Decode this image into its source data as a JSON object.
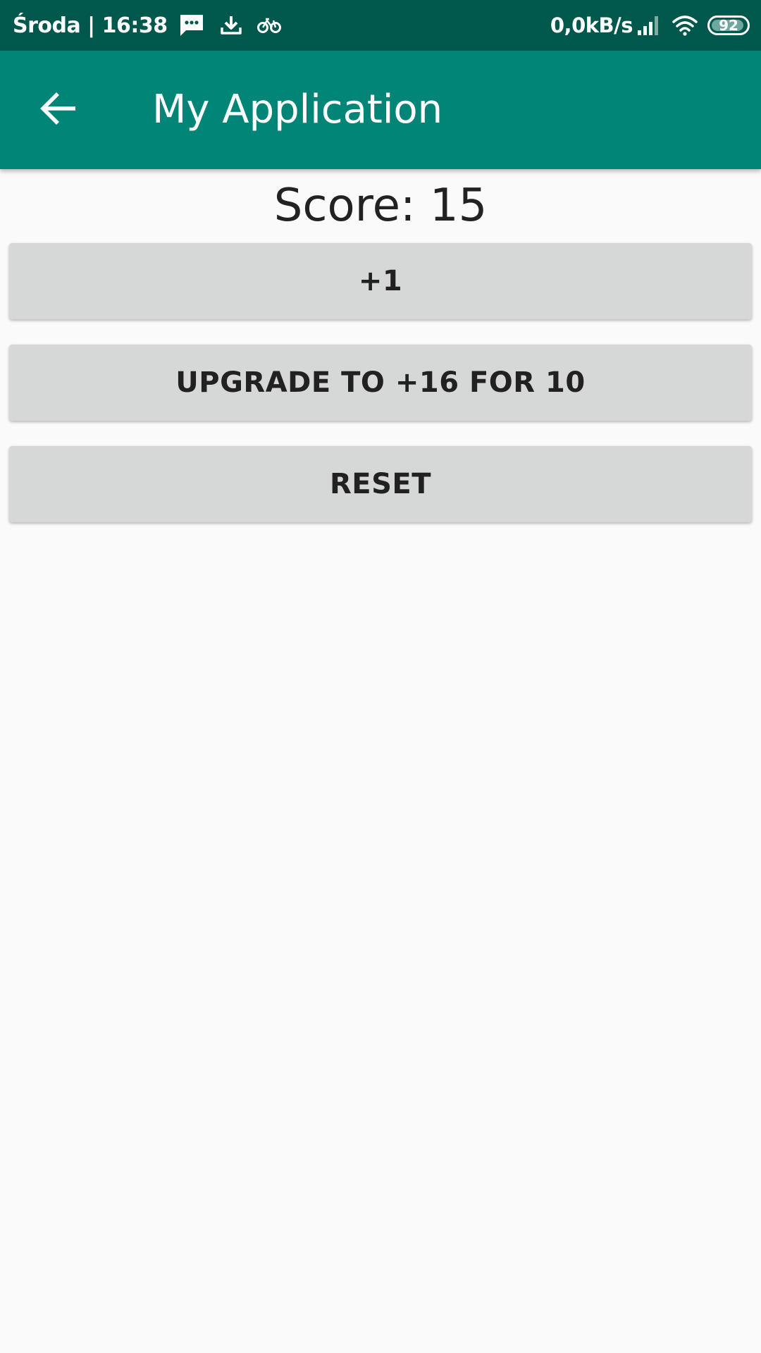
{
  "status_bar": {
    "day_time": "Środa | 16:38",
    "net_speed": "0,0kB/s",
    "battery_level": "92",
    "icons": [
      "message-icon",
      "download-icon",
      "bike-icon",
      "signal-icon",
      "wifi-icon",
      "battery-icon"
    ]
  },
  "app_bar": {
    "title": "My Application",
    "back_icon": "arrow-back-icon",
    "color": "#008577"
  },
  "main": {
    "score_label": "Score: 15",
    "buttons": {
      "plus_one": "+1",
      "upgrade": "UPGRADE TO +16 FOR 10",
      "reset": "RESET"
    }
  },
  "colors": {
    "status_bar": "#00574b",
    "app_bar": "#008577",
    "background": "#fafafa",
    "button": "#d6d7d7"
  }
}
